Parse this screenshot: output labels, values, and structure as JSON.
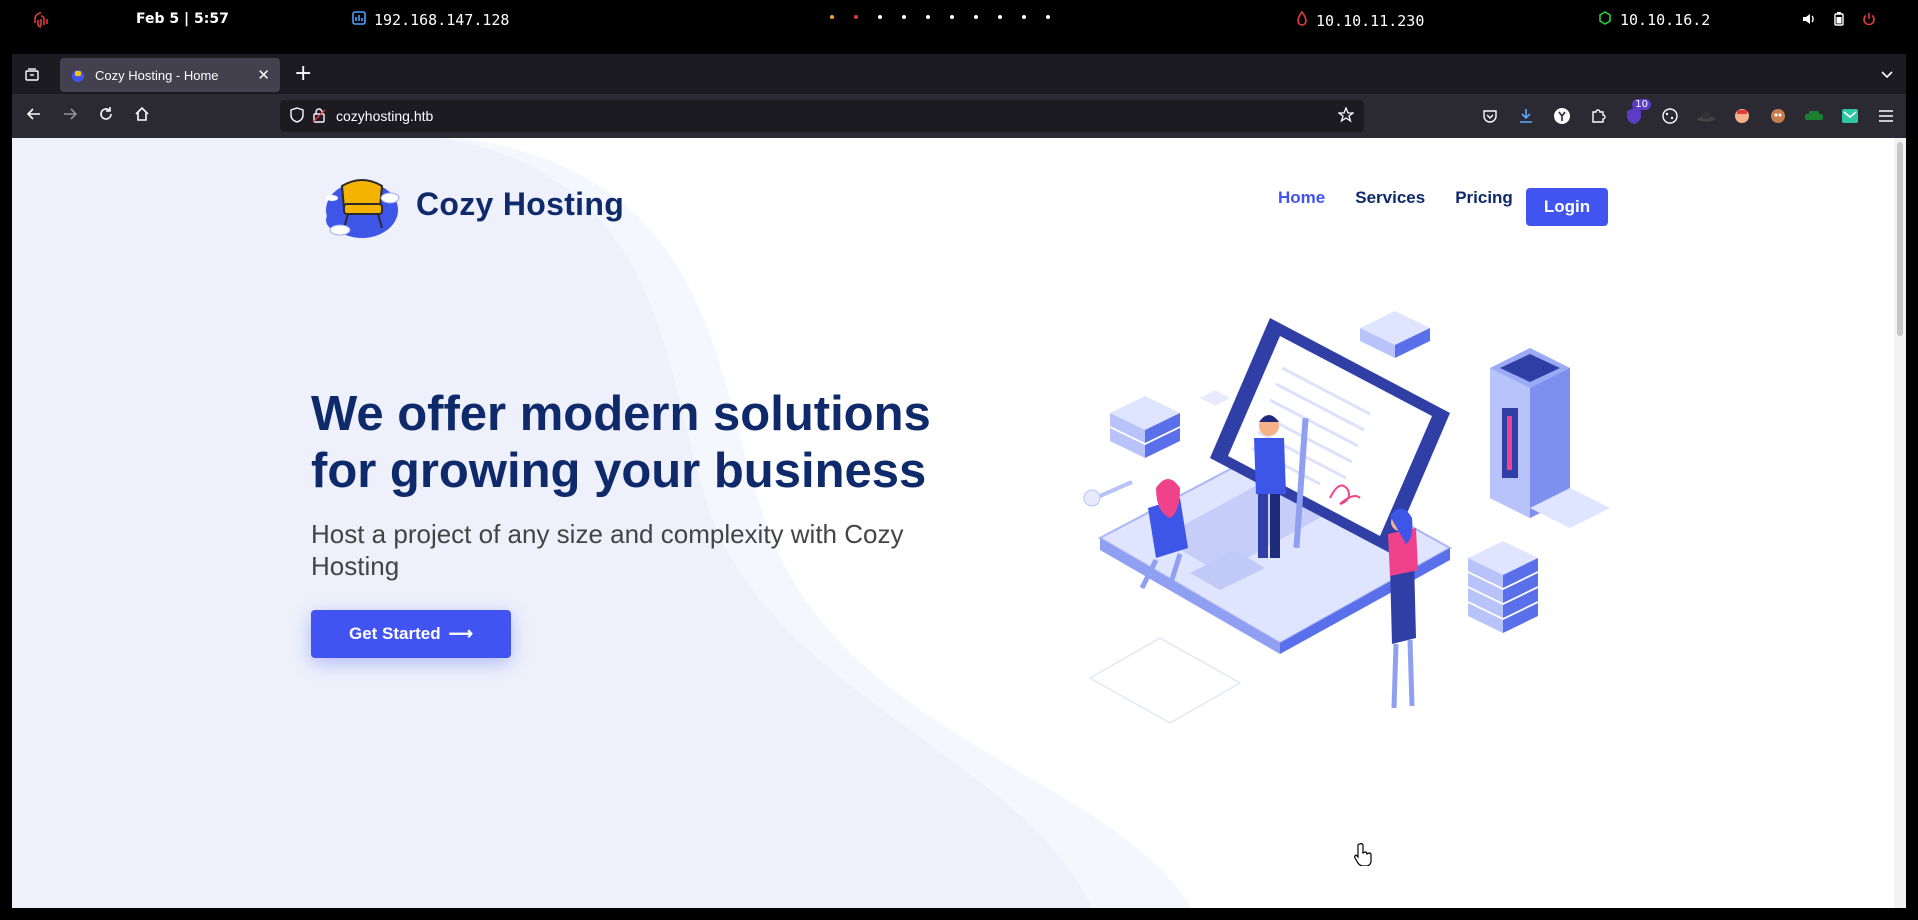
{
  "desktop": {
    "clock": "Feb 5 | 5:57",
    "local_ip": "192.168.147.128",
    "vpn_ip": "10.10.11.230",
    "target_ip": "10.10.16.2",
    "workspaces": 10
  },
  "browser": {
    "tab": {
      "title": "Cozy Hosting - Home"
    },
    "url": "cozyhosting.htb",
    "extension_badge": "10"
  },
  "site": {
    "brand": "Cozy Hosting",
    "nav": {
      "home": "Home",
      "services": "Services",
      "pricing": "Pricing",
      "login": "Login"
    },
    "hero": {
      "title": "We offer modern solutions for growing your business",
      "subtitle": "Host a project of any size and complexity with Cozy Hosting",
      "cta": "Get Started",
      "cta_arrow": "⟶"
    }
  },
  "colors": {
    "accent": "#4154f1",
    "heading": "#0e2a6b",
    "alert_red": "#e23b3b",
    "vpn_green": "#2ecc40"
  },
  "icons": {
    "topbar": [
      "fingerprint-icon",
      "network-icon",
      "vpn-icon",
      "target-icon",
      "volume-icon",
      "battery-icon",
      "power-icon"
    ],
    "chrome": [
      "back-icon",
      "forward-icon",
      "reload-icon",
      "home-icon",
      "shield-icon",
      "lock-icon",
      "star-icon"
    ]
  }
}
